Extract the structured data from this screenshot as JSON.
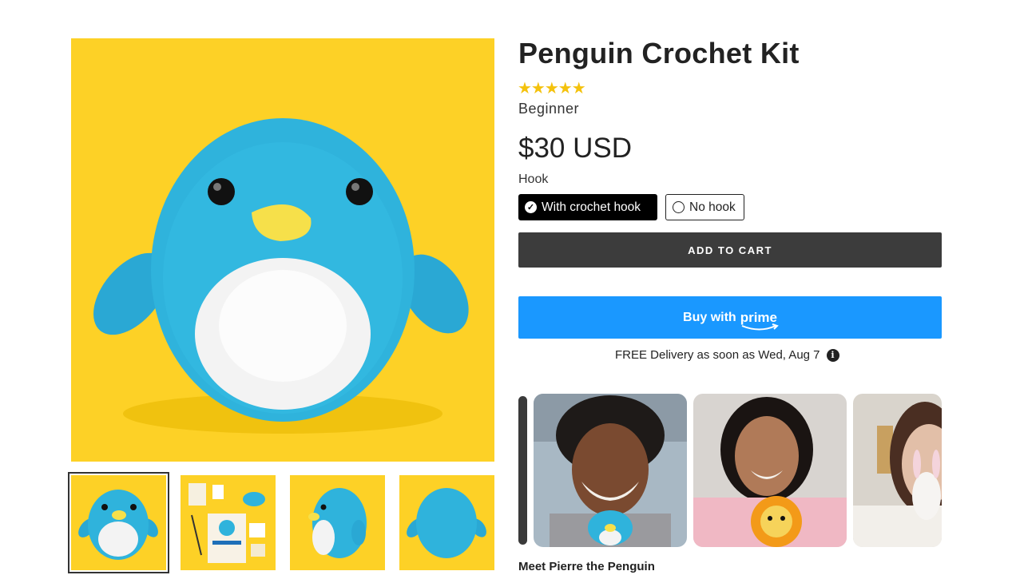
{
  "product": {
    "title": "Penguin Crochet Kit",
    "stars": "★★★★★",
    "rating": 5,
    "level": "Beginner",
    "price": "$30 USD"
  },
  "options": {
    "label": "Hook",
    "choices": [
      "With crochet hook",
      "No hook"
    ],
    "selected": "With crochet hook"
  },
  "buttons": {
    "add_to_cart": "ADD TO CART",
    "buy_with": "Buy with",
    "prime": "prime"
  },
  "delivery": {
    "text": "FREE Delivery as soon as Wed, Aug 7",
    "info_icon": "i"
  },
  "ugc": {
    "caption": "Meet Pierre the Penguin"
  },
  "colors": {
    "yellow_bg": "#fdd126",
    "penguin_blue": "#2fb3dc",
    "prime_blue": "#1a98ff",
    "cart_dark": "#3c3c3c",
    "star": "#f4c20d"
  },
  "icons": [
    "star-icon",
    "check-icon",
    "radio-icon",
    "info-icon",
    "prime-smile-icon"
  ]
}
